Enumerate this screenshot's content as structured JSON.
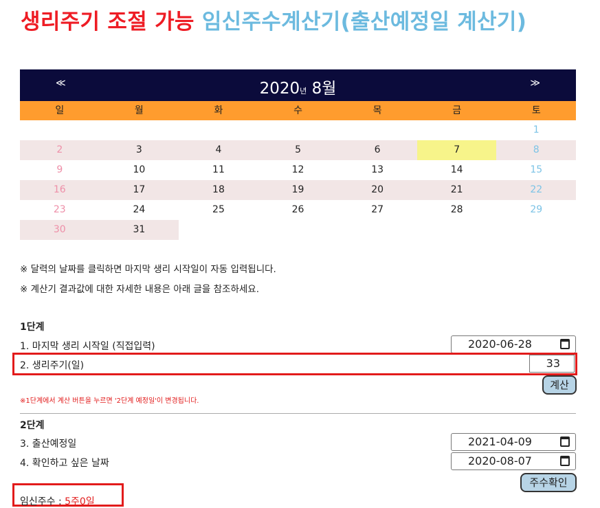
{
  "title": {
    "red": "생리주기 조절 가능",
    "blue": "임신주수계산기(출산예정일 계산기)"
  },
  "calendar": {
    "prev": "≪",
    "next": "≫",
    "year": "2020",
    "year_unit": "년",
    "month": "8월",
    "weekdays": [
      "일",
      "월",
      "화",
      "수",
      "목",
      "금",
      "토"
    ],
    "weeks": [
      [
        "",
        "",
        "",
        "",
        "",
        "",
        "1"
      ],
      [
        "2",
        "3",
        "4",
        "5",
        "6",
        "7",
        "8"
      ],
      [
        "9",
        "10",
        "11",
        "12",
        "13",
        "14",
        "15"
      ],
      [
        "16",
        "17",
        "18",
        "19",
        "20",
        "21",
        "22"
      ],
      [
        "23",
        "24",
        "25",
        "26",
        "27",
        "28",
        "29"
      ],
      [
        "30",
        "31",
        "",
        "",
        "",
        "",
        ""
      ]
    ],
    "today": "7"
  },
  "notes": [
    "※ 달력의 날짜를 클릭하면 마지막 생리 시작일이 자동 입력됩니다.",
    "※ 계산기 결과값에 대한 자세한 내용은 아래 글을 참조하세요."
  ],
  "step1": {
    "title": "1단계",
    "last_period_label": "1. 마지막 생리 시작일 (직접입력)",
    "last_period_value": "2020-06-28",
    "cycle_label": "2. 생리주기(일)",
    "cycle_value": "33",
    "calc_button": "계산",
    "warning": "※1단계에서 계산 버튼을 누르면 '2단계 예정일'이 변경됩니다."
  },
  "step2": {
    "title": "2단계",
    "due_label": "3. 출산예정일",
    "due_value": "2021-04-09",
    "check_label": "4. 확인하고 싶은 날짜",
    "check_value": "2020-08-07",
    "check_button": "주수확인"
  },
  "result": {
    "label": "임신주수 : ",
    "value": "5주0일"
  },
  "colors": {
    "title_red": "#ee1c24",
    "title_blue": "#6cbadf",
    "header_navy": "#0b0b3b",
    "weekday_orange": "#ff9c2e",
    "today_yellow": "#f7f48a",
    "highlight_red": "#e21b1b"
  }
}
